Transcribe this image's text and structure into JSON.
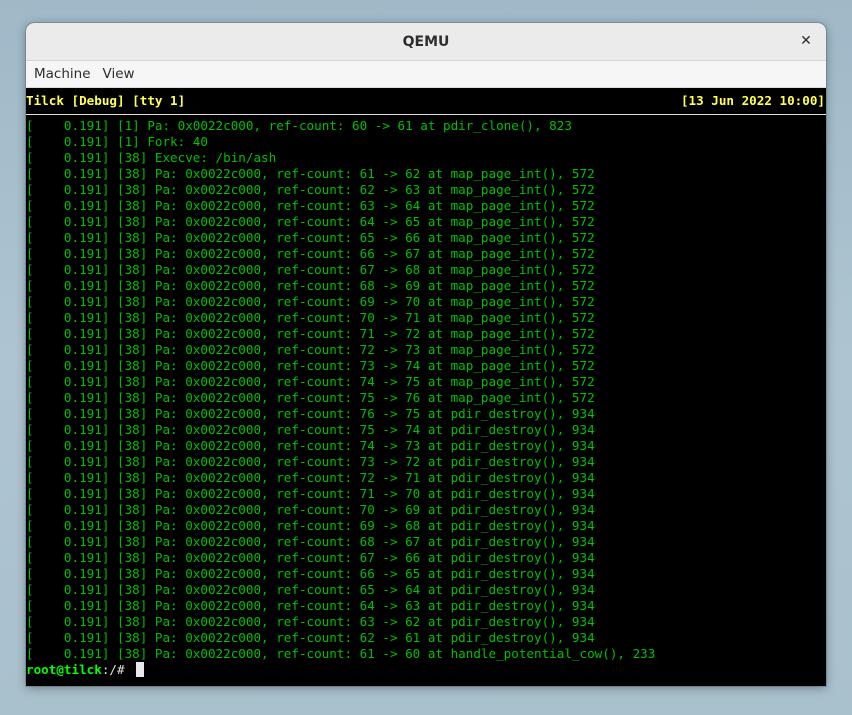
{
  "window": {
    "title": "QEMU",
    "close_glyph": "✕"
  },
  "menu": {
    "items": [
      "Machine",
      "View"
    ]
  },
  "terminal": {
    "header_left": "Tilck [Debug] [tty 1]",
    "header_right": "[13 Jun 2022 10:00]",
    "lines": [
      "[    0.191] [1] Pa: 0x0022c000, ref-count: 60 -> 61 at pdir_clone(), 823",
      "[    0.191] [1] Fork: 40",
      "[    0.191] [38] Execve: /bin/ash",
      "[    0.191] [38] Pa: 0x0022c000, ref-count: 61 -> 62 at map_page_int(), 572",
      "[    0.191] [38] Pa: 0x0022c000, ref-count: 62 -> 63 at map_page_int(), 572",
      "[    0.191] [38] Pa: 0x0022c000, ref-count: 63 -> 64 at map_page_int(), 572",
      "[    0.191] [38] Pa: 0x0022c000, ref-count: 64 -> 65 at map_page_int(), 572",
      "[    0.191] [38] Pa: 0x0022c000, ref-count: 65 -> 66 at map_page_int(), 572",
      "[    0.191] [38] Pa: 0x0022c000, ref-count: 66 -> 67 at map_page_int(), 572",
      "[    0.191] [38] Pa: 0x0022c000, ref-count: 67 -> 68 at map_page_int(), 572",
      "[    0.191] [38] Pa: 0x0022c000, ref-count: 68 -> 69 at map_page_int(), 572",
      "[    0.191] [38] Pa: 0x0022c000, ref-count: 69 -> 70 at map_page_int(), 572",
      "[    0.191] [38] Pa: 0x0022c000, ref-count: 70 -> 71 at map_page_int(), 572",
      "[    0.191] [38] Pa: 0x0022c000, ref-count: 71 -> 72 at map_page_int(), 572",
      "[    0.191] [38] Pa: 0x0022c000, ref-count: 72 -> 73 at map_page_int(), 572",
      "[    0.191] [38] Pa: 0x0022c000, ref-count: 73 -> 74 at map_page_int(), 572",
      "[    0.191] [38] Pa: 0x0022c000, ref-count: 74 -> 75 at map_page_int(), 572",
      "[    0.191] [38] Pa: 0x0022c000, ref-count: 75 -> 76 at map_page_int(), 572",
      "[    0.191] [38] Pa: 0x0022c000, ref-count: 76 -> 75 at pdir_destroy(), 934",
      "[    0.191] [38] Pa: 0x0022c000, ref-count: 75 -> 74 at pdir_destroy(), 934",
      "[    0.191] [38] Pa: 0x0022c000, ref-count: 74 -> 73 at pdir_destroy(), 934",
      "[    0.191] [38] Pa: 0x0022c000, ref-count: 73 -> 72 at pdir_destroy(), 934",
      "[    0.191] [38] Pa: 0x0022c000, ref-count: 72 -> 71 at pdir_destroy(), 934",
      "[    0.191] [38] Pa: 0x0022c000, ref-count: 71 -> 70 at pdir_destroy(), 934",
      "[    0.191] [38] Pa: 0x0022c000, ref-count: 70 -> 69 at pdir_destroy(), 934",
      "[    0.191] [38] Pa: 0x0022c000, ref-count: 69 -> 68 at pdir_destroy(), 934",
      "[    0.191] [38] Pa: 0x0022c000, ref-count: 68 -> 67 at pdir_destroy(), 934",
      "[    0.191] [38] Pa: 0x0022c000, ref-count: 67 -> 66 at pdir_destroy(), 934",
      "[    0.191] [38] Pa: 0x0022c000, ref-count: 66 -> 65 at pdir_destroy(), 934",
      "[    0.191] [38] Pa: 0x0022c000, ref-count: 65 -> 64 at pdir_destroy(), 934",
      "[    0.191] [38] Pa: 0x0022c000, ref-count: 64 -> 63 at pdir_destroy(), 934",
      "[    0.191] [38] Pa: 0x0022c000, ref-count: 63 -> 62 at pdir_destroy(), 934",
      "[    0.191] [38] Pa: 0x0022c000, ref-count: 62 -> 61 at pdir_destroy(), 934",
      "[    0.191] [38] Pa: 0x0022c000, ref-count: 61 -> 60 at handle_potential_cow(), 233"
    ],
    "prompt_user": "root@tilck",
    "prompt_path": ":/# "
  },
  "colors": {
    "log_text": "#00c000",
    "header_text": "#ffff55",
    "prompt_user": "#00ff00"
  }
}
